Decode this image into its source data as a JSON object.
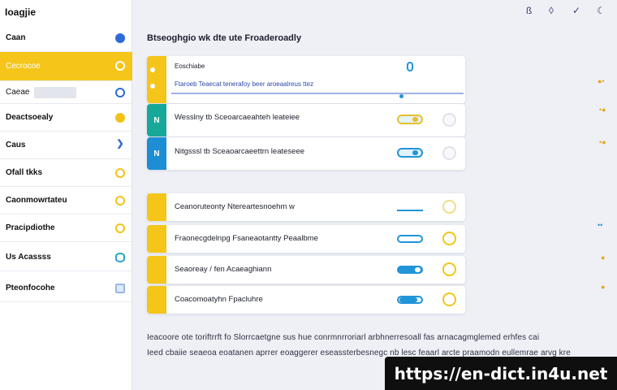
{
  "app": {
    "title": "Ioagjie"
  },
  "top_icons": [
    "bell-icon",
    "shield-icon",
    "check-icon",
    "moon-icon"
  ],
  "sidebar": {
    "items": [
      {
        "label": "Caan"
      },
      {
        "label": "Cecrocoe"
      },
      {
        "label": "Caeae"
      },
      {
        "label": "Deactsoealy"
      },
      {
        "label": "Caus"
      },
      {
        "label": "Ofall tkks"
      },
      {
        "label": "Caonmowrtateu"
      },
      {
        "label": "Pracipdiothe"
      },
      {
        "label": "Us Acassss"
      },
      {
        "label": "Pteonfocohe"
      }
    ]
  },
  "main": {
    "title": "Btseoghgio wk dte ute Froaderoadly",
    "cards": [
      {
        "line1": "Eoschiabe",
        "line2": "Ftaroeb Teaecat tenerafoy beer aroeaalreus ttez"
      },
      {
        "letter": "N",
        "label": "Wesslny  tb  Sceoarcaeahteh leateiee"
      },
      {
        "letter": "N",
        "label": "Nitgsssl  tb  Sceaoarcaeettrn leateseee"
      },
      {
        "label": "Ceanoruteonty Ntereartesnoehm  w"
      },
      {
        "label": "Fraonecgdelnpg Fsaneaotantty Peaalbme"
      },
      {
        "label": "Seaoreay  /  fen  Acaeaghiann"
      },
      {
        "label": "Coacomoatyhn Fpacluhre"
      }
    ],
    "footer_line1": "Ieacoore ote toriftrrft fo Slorrcaetgne sus hue conrmnrroriarl arbhnerresoall fas arnacagmglemed erhfes cai",
    "footer_line2": "Ieed cbaiie seaeoa eoatanen aprrer eoaggerer eseassterbesnegc nb lesc feaarl arcte praamodn eullemrae arvg kre"
  },
  "watermark": "https://en-dict.in4u.net"
}
